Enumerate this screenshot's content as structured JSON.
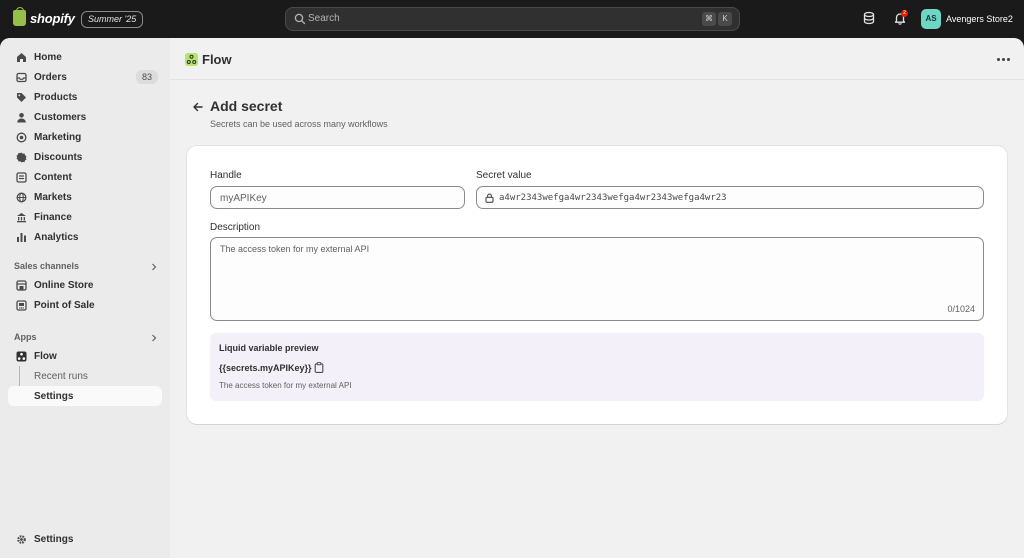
{
  "topbar": {
    "logo_text": "shopify",
    "edition": "Summer '25",
    "search_placeholder": "Search",
    "shortcut_keys": [
      "⌘",
      "K"
    ],
    "notification_count": "2",
    "avatar_initials": "AS",
    "store_name": "Avengers Store2"
  },
  "sidebar": {
    "items": [
      {
        "label": "Home",
        "icon": "home-icon"
      },
      {
        "label": "Orders",
        "icon": "inbox-icon",
        "badge": "83"
      },
      {
        "label": "Products",
        "icon": "tag-icon"
      },
      {
        "label": "Customers",
        "icon": "person-icon"
      },
      {
        "label": "Marketing",
        "icon": "target-icon"
      },
      {
        "label": "Discounts",
        "icon": "discount-icon"
      },
      {
        "label": "Content",
        "icon": "content-icon"
      },
      {
        "label": "Markets",
        "icon": "globe-icon"
      },
      {
        "label": "Finance",
        "icon": "bank-icon"
      },
      {
        "label": "Analytics",
        "icon": "bar-chart-icon"
      }
    ],
    "sales_channels_header": "Sales channels",
    "sales_channels": [
      {
        "label": "Online Store",
        "icon": "store-icon"
      },
      {
        "label": "Point of Sale",
        "icon": "pos-icon"
      }
    ],
    "apps_header": "Apps",
    "apps": [
      {
        "label": "Flow",
        "icon": "flow-app-icon"
      },
      {
        "label": "Recent runs"
      },
      {
        "label": "Settings",
        "active": true
      }
    ],
    "footer_settings": "Settings"
  },
  "app_header": {
    "title": "Flow"
  },
  "page": {
    "title": "Add secret",
    "subtitle": "Secrets can be used across many workflows"
  },
  "form": {
    "handle_label": "Handle",
    "handle_value": "myAPIKey",
    "secret_label": "Secret value",
    "secret_value": "a4wr2343wefga4wr2343wefga4wr2343wefga4wr23",
    "description_label": "Description",
    "description_value": "The access token for my external API",
    "description_counter": "0/1024"
  },
  "preview": {
    "title": "Liquid variable preview",
    "variable": "{{secrets.myAPIKey}}",
    "description": "The access token for my external API"
  }
}
